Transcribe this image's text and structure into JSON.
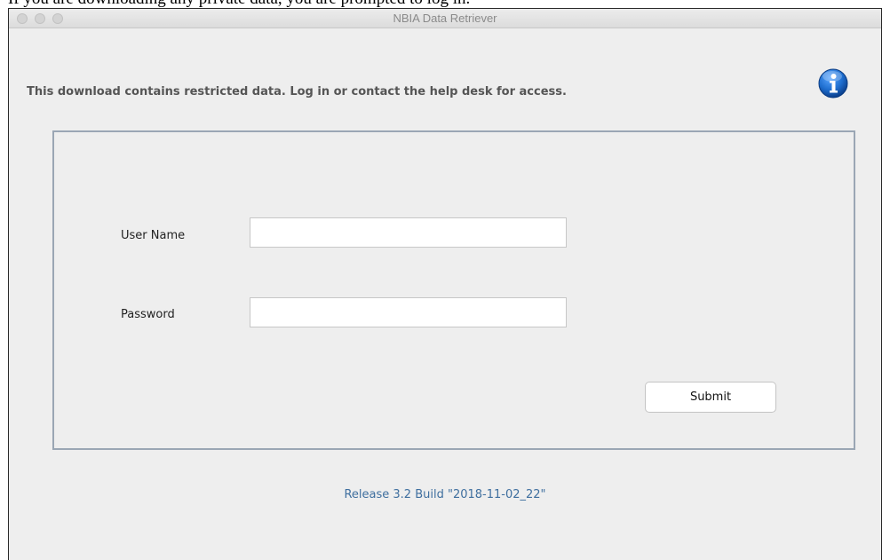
{
  "caption": "If you are downloading any private data, you are prompted to log in.",
  "window": {
    "title": "NBIA Data Retriever"
  },
  "notice": "This download contains restricted data. Log in or contact the help desk for access.",
  "icons": {
    "info": "info-icon"
  },
  "form": {
    "username_label": "User Name",
    "username_value": "",
    "password_label": "Password",
    "password_value": "",
    "submit_label": "Submit"
  },
  "footer": {
    "release": "Release 3.2 Build \"2018-11-02_22\""
  },
  "colors": {
    "panel_border": "#9aa6b4",
    "release_text": "#3f6f9f",
    "info_icon": "#1f6fd0"
  }
}
